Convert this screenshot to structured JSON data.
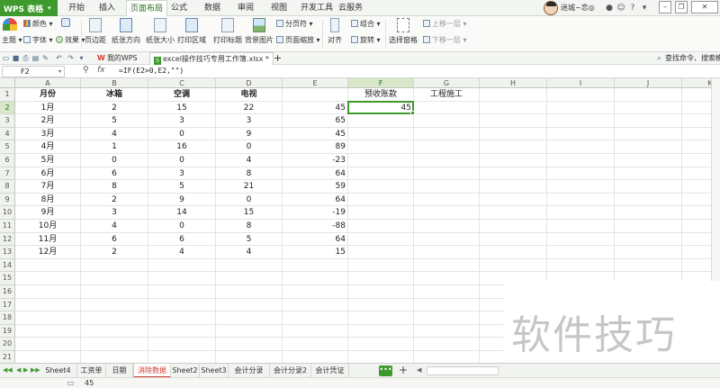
{
  "app": {
    "brand": "WPS 表格",
    "menu_tabs": [
      "开始",
      "插入",
      "页面布局",
      "公式",
      "数据",
      "审阅",
      "视图",
      "开发工具",
      "云服务"
    ],
    "active_menu_tab": "页面布局",
    "user_name": "迷城~恋◎"
  },
  "ribbon": {
    "theme_label": "主题",
    "colors_label": "颜色",
    "fonts_label": "字体",
    "effects_label": "效果",
    "margins_label": "页边距",
    "orientation_label": "纸张方向",
    "size_label": "纸张大小",
    "print_area_label": "打印区域",
    "print_titles_label": "打印标题",
    "background_label": "背景图片",
    "page_break_label": "分页符",
    "page_zoom_label": "页面缩放",
    "align_label": "对齐",
    "group_label": "组合",
    "rotate_label": "旋转",
    "selection_pane_label": "选择窗格",
    "bring_forward_label": "上移一层",
    "send_backward_label": "下移一层"
  },
  "doc_tabs": {
    "my_wps": "我的WPS",
    "file": "excel操作技巧专用工作簿.xlsx *",
    "add": "+"
  },
  "search": {
    "placeholder": "查找命令、搜索模板"
  },
  "formula_bar": {
    "cell_ref": "F2",
    "fx": "fx",
    "formula": "=IF(E2>0,E2,\"\")"
  },
  "columns": [
    "A",
    "B",
    "C",
    "D",
    "E",
    "F",
    "G",
    "H",
    "I",
    "J",
    "K"
  ],
  "row_numbers": [
    "1",
    "2",
    "3",
    "4",
    "5",
    "6",
    "7",
    "8",
    "9",
    "10",
    "11",
    "12",
    "13",
    "14",
    "15",
    "16",
    "17",
    "18",
    "19",
    "20",
    "21"
  ],
  "sheet": {
    "headers": [
      "月份",
      "冰箱",
      "空调",
      "电视",
      "",
      "预收账款",
      "工程施工"
    ],
    "rows": [
      [
        "1月",
        "2",
        "15",
        "22",
        "45",
        "45"
      ],
      [
        "2月",
        "5",
        "3",
        "3",
        "65",
        ""
      ],
      [
        "3月",
        "4",
        "0",
        "9",
        "45",
        ""
      ],
      [
        "4月",
        "1",
        "16",
        "0",
        "89",
        ""
      ],
      [
        "5月",
        "0",
        "0",
        "4",
        "-23",
        ""
      ],
      [
        "6月",
        "6",
        "3",
        "8",
        "64",
        ""
      ],
      [
        "7月",
        "8",
        "5",
        "21",
        "59",
        ""
      ],
      [
        "8月",
        "2",
        "9",
        "0",
        "64",
        ""
      ],
      [
        "9月",
        "3",
        "14",
        "15",
        "-19",
        ""
      ],
      [
        "10月",
        "4",
        "0",
        "8",
        "-88",
        ""
      ],
      [
        "11月",
        "6",
        "6",
        "5",
        "64",
        ""
      ],
      [
        "12月",
        "2",
        "4",
        "4",
        "15",
        ""
      ]
    ]
  },
  "sheet_tabs": [
    "Sheet4",
    "工资单",
    "日期",
    "消除数据",
    "Sheet2",
    "Sheet3",
    "会计分录",
    "会计分录2",
    "会计凭证"
  ],
  "active_sheet_tab": "消除数据",
  "more_tabs": "•••",
  "add_sheet": "+",
  "status": {
    "value": "45"
  },
  "watermark": "软件技巧",
  "colors": {
    "accent": "#3f9a2e",
    "active_tab": "#d23b2f"
  }
}
